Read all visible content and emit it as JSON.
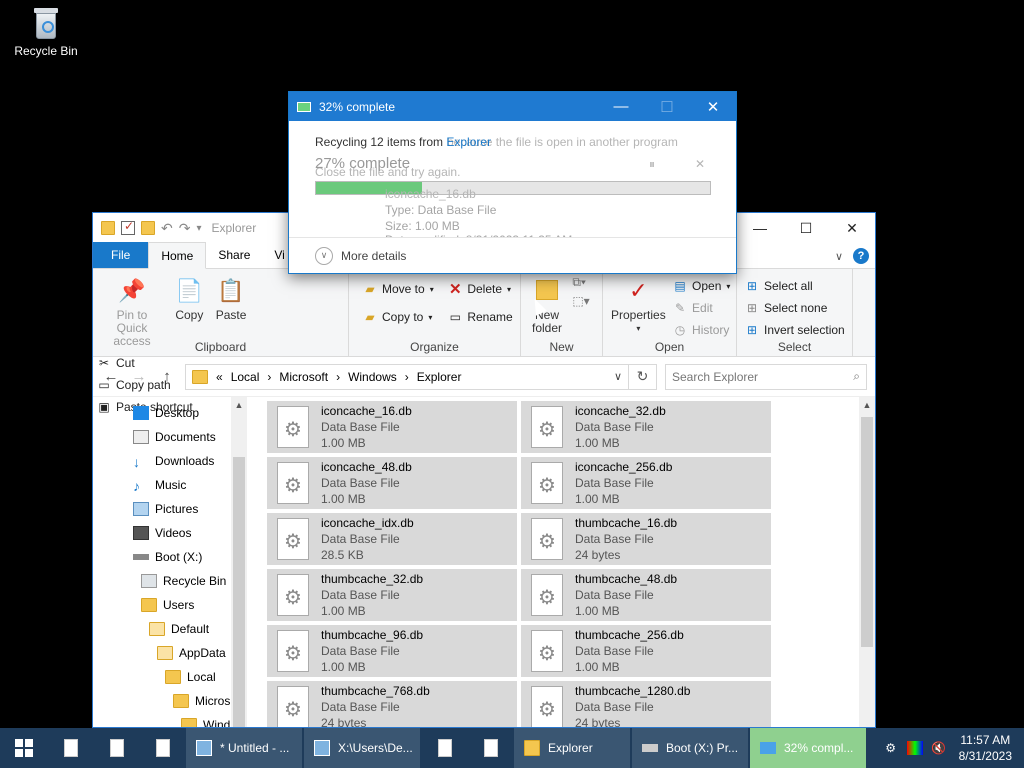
{
  "desktop": {
    "recycle_bin_label": "Recycle Bin"
  },
  "explorer": {
    "title": "Explorer",
    "tabs": {
      "file": "File",
      "home": "Home",
      "share": "Share",
      "view": "Vi"
    },
    "ribbon": {
      "clipboard": {
        "label": "Clipboard",
        "pin": "Pin to Quick access",
        "copy": "Copy",
        "paste": "Paste",
        "cut": "Cut",
        "copy_path": "Copy path",
        "paste_shortcut": "Paste shortcut"
      },
      "organize": {
        "label": "Organize",
        "move_to": "Move to",
        "copy_to": "Copy to",
        "delete": "Delete",
        "rename": "Rename"
      },
      "new": {
        "label": "New",
        "new_folder": "New folder"
      },
      "open": {
        "label": "Open",
        "properties": "Properties",
        "open": "Open",
        "edit": "Edit",
        "history": "History"
      },
      "select": {
        "label": "Select",
        "select_all": "Select all",
        "select_none": "Select none",
        "invert": "Invert selection"
      }
    },
    "address": {
      "prefix": "«",
      "crumbs": [
        "Local",
        "Microsoft",
        "Windows",
        "Explorer"
      ]
    },
    "search_placeholder": "Search Explorer",
    "nav": [
      {
        "label": "Desktop"
      },
      {
        "label": "Documents"
      },
      {
        "label": "Downloads"
      },
      {
        "label": "Music"
      },
      {
        "label": "Pictures"
      },
      {
        "label": "Videos"
      },
      {
        "label": "Boot (X:)"
      },
      {
        "label": "Recycle Bin"
      },
      {
        "label": "Users"
      },
      {
        "label": "Default"
      },
      {
        "label": "AppData"
      },
      {
        "label": "Local"
      },
      {
        "label": "Micros"
      },
      {
        "label": "Wind"
      }
    ],
    "files": [
      {
        "name": "iconcache_16.db",
        "type": "Data Base File",
        "size": "1.00 MB"
      },
      {
        "name": "iconcache_32.db",
        "type": "Data Base File",
        "size": "1.00 MB"
      },
      {
        "name": "iconcache_48.db",
        "type": "Data Base File",
        "size": "1.00 MB"
      },
      {
        "name": "iconcache_256.db",
        "type": "Data Base File",
        "size": "1.00 MB"
      },
      {
        "name": "iconcache_idx.db",
        "type": "Data Base File",
        "size": "28.5 KB"
      },
      {
        "name": "thumbcache_16.db",
        "type": "Data Base File",
        "size": "24 bytes"
      },
      {
        "name": "thumbcache_32.db",
        "type": "Data Base File",
        "size": "1.00 MB"
      },
      {
        "name": "thumbcache_48.db",
        "type": "Data Base File",
        "size": "1.00 MB"
      },
      {
        "name": "thumbcache_96.db",
        "type": "Data Base File",
        "size": "1.00 MB"
      },
      {
        "name": "thumbcache_256.db",
        "type": "Data Base File",
        "size": "1.00 MB"
      },
      {
        "name": "thumbcache_768.db",
        "type": "Data Base File",
        "size": "24 bytes"
      },
      {
        "name": "thumbcache_1280.db",
        "type": "Data Base File",
        "size": "24 bytes"
      }
    ]
  },
  "dialog": {
    "title": "32% complete",
    "message_prefix": "Recycling 12 items from ",
    "message_link": "Explorer",
    "ghost_message": "because the file is open in another program",
    "ghost_retry": "Close the file and try again.",
    "percent": "27% complete",
    "progress": 0.27,
    "ghost_file": "iconcache_16.db",
    "ghost_type": "Type: Data Base File",
    "ghost_size": "Size: 1.00 MB",
    "ghost_modified": "Date modified: 8/31/2023 11:35 AM",
    "more_details": "More details"
  },
  "taskbar": {
    "apps": [
      {
        "label": "* Untitled - ..."
      },
      {
        "label": "X:\\Users\\De..."
      },
      {
        "label": "Explorer"
      },
      {
        "label": "Boot (X:) Pr..."
      },
      {
        "label": "32% compl..."
      }
    ],
    "time": "11:57 AM",
    "date": "8/31/2023"
  },
  "colors": {
    "accent": "#1979ca",
    "taskbar": "#1e3b5a",
    "progress": "#06b025"
  }
}
